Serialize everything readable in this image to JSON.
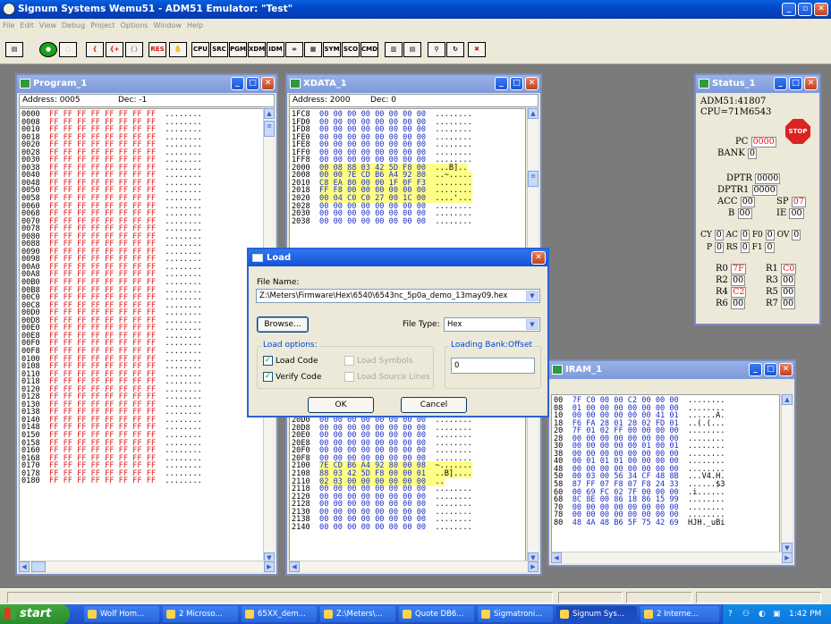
{
  "app": {
    "title": "Signum Systems Wemu51 - ADM51 Emulator: \"Test\""
  },
  "menu": [
    "File",
    "Edit",
    "View",
    "Debug",
    "Project",
    "Options",
    "Window",
    "Help"
  ],
  "toolbar": [
    "",
    "",
    "",
    "",
    "",
    "",
    "RES",
    "",
    "CPU",
    "SRC",
    "PGM",
    "XDM",
    "IDM",
    "",
    "",
    "SYM",
    "SCO",
    "CMD",
    "",
    "",
    "",
    "",
    ""
  ],
  "program": {
    "title": "Program_1",
    "address_label": "Address: 0005",
    "dec_label": "Dec: -1",
    "rows": [
      [
        "0000",
        "FF FF FF FF FF FF FF FF",
        "........"
      ],
      [
        "0008",
        "FF FF FF FF FF FF FF FF",
        "........"
      ],
      [
        "0010",
        "FF FF FF FF FF FF FF FF",
        "........"
      ],
      [
        "0018",
        "FF FF FF FF FF FF FF FF",
        "........"
      ],
      [
        "0020",
        "FF FF FF FF FF FF FF FF",
        "........"
      ],
      [
        "0028",
        "FF FF FF FF FF FF FF FF",
        "........"
      ],
      [
        "0030",
        "FF FF FF FF FF FF FF FF",
        "........"
      ],
      [
        "0038",
        "FF FF FF FF FF FF FF FF",
        "........"
      ],
      [
        "0040",
        "FF FF FF FF FF FF FF FF",
        "........"
      ],
      [
        "0048",
        "FF FF FF FF FF FF FF FF",
        "........"
      ],
      [
        "0050",
        "FF FF FF FF FF FF FF FF",
        "........"
      ],
      [
        "0058",
        "FF FF FF FF FF FF FF FF",
        "........"
      ],
      [
        "0060",
        "FF FF FF FF FF FF FF FF",
        "........"
      ],
      [
        "0068",
        "FF FF FF FF FF FF FF FF",
        "........"
      ],
      [
        "0070",
        "FF FF FF FF FF FF FF FF",
        "........"
      ],
      [
        "0078",
        "FF FF FF FF FF FF FF FF",
        "........"
      ],
      [
        "0080",
        "FF FF FF FF FF FF FF FF",
        "........"
      ],
      [
        "0088",
        "FF FF FF FF FF FF FF FF",
        "........"
      ],
      [
        "0090",
        "FF FF FF FF FF FF FF FF",
        "........"
      ],
      [
        "0098",
        "FF FF FF FF FF FF FF FF",
        "........"
      ],
      [
        "00A0",
        "FF FF FF FF FF FF FF FF",
        "........"
      ],
      [
        "00A8",
        "FF FF FF FF FF FF FF FF",
        "........"
      ],
      [
        "00B0",
        "FF FF FF FF FF FF FF FF",
        "........"
      ],
      [
        "00B8",
        "FF FF FF FF FF FF FF FF",
        "........"
      ],
      [
        "00C0",
        "FF FF FF FF FF FF FF FF",
        "........"
      ],
      [
        "00C8",
        "FF FF FF FF FF FF FF FF",
        "........"
      ],
      [
        "00D0",
        "FF FF FF FF FF FF FF FF",
        "........"
      ],
      [
        "00D8",
        "FF FF FF FF FF FF FF FF",
        "........"
      ],
      [
        "00E0",
        "FF FF FF FF FF FF FF FF",
        "........"
      ],
      [
        "00E8",
        "FF FF FF FF FF FF FF FF",
        "........"
      ],
      [
        "00F0",
        "FF FF FF FF FF FF FF FF",
        "........"
      ],
      [
        "00F8",
        "FF FF FF FF FF FF FF FF",
        "........"
      ],
      [
        "0100",
        "FF FF FF FF FF FF FF FF",
        "........"
      ],
      [
        "0108",
        "FF FF FF FF FF FF FF FF",
        "........"
      ],
      [
        "0110",
        "FF FF FF FF FF FF FF FF",
        "........"
      ],
      [
        "0118",
        "FF FF FF FF FF FF FF FF",
        "........"
      ],
      [
        "0120",
        "FF FF FF FF FF FF FF FF",
        "........"
      ],
      [
        "0128",
        "FF FF FF FF FF FF FF FF",
        "........"
      ],
      [
        "0130",
        "FF FF FF FF FF FF FF FF",
        "........"
      ],
      [
        "0138",
        "FF FF FF FF FF FF FF FF",
        "........"
      ],
      [
        "0140",
        "FF FF FF FF FF FF FF FF",
        "........"
      ],
      [
        "0148",
        "FF FF FF FF FF FF FF FF",
        "........"
      ],
      [
        "0150",
        "FF FF FF FF FF FF FF FF",
        "........"
      ],
      [
        "0158",
        "FF FF FF FF FF FF FF FF",
        "........"
      ],
      [
        "0160",
        "FF FF FF FF FF FF FF FF",
        "........"
      ],
      [
        "0168",
        "FF FF FF FF FF FF FF FF",
        "........"
      ],
      [
        "0170",
        "FF FF FF FF FF FF FF FF",
        "........"
      ],
      [
        "0178",
        "FF FF FF FF FF FF FF FF",
        "........"
      ],
      [
        "0180",
        "FF FF FF FF FF FF FF FF",
        "........"
      ]
    ]
  },
  "xdata": {
    "title": "XDATA_1",
    "address_label": "Address: 2000",
    "dec_label": "Dec: 0",
    "rows_top": [
      [
        "1FC8",
        "00 00 00 00 00 00 00 00",
        "........",
        false
      ],
      [
        "1FD0",
        "00 00 00 00 00 00 00 00",
        "........",
        false
      ],
      [
        "1FD8",
        "00 00 00 00 00 00 00 00",
        "........",
        false
      ],
      [
        "1FE0",
        "00 00 00 00 00 00 00 00",
        "........",
        false
      ],
      [
        "1FE8",
        "00 00 00 00 00 00 00 00",
        "........",
        false
      ],
      [
        "1FF0",
        "00 00 00 00 00 00 00 00",
        "........",
        false
      ],
      [
        "1FF8",
        "00 00 00 00 00 00 00 00",
        "........",
        false
      ],
      [
        "2000",
        "00 08 88 03 42 5D F8 00",
        "...B]..",
        true
      ],
      [
        "2008",
        "00 00 7E CD B6 A4 92 80",
        "..~.....",
        true
      ],
      [
        "2010",
        "C8 EA 80 00 00 1F 0F F3",
        "........",
        true
      ],
      [
        "2018",
        "FF F8 00 00 00 00 00 00",
        "........",
        true
      ],
      [
        "2020",
        "00 04 C0 C0 27 00 1C 00",
        "....'...",
        true
      ],
      [
        "2028",
        "00 00 00 00 00 00 00 00",
        "........",
        false
      ],
      [
        "2030",
        "00 00 00 00 00 00 00 00",
        "........",
        false
      ],
      [
        "2038",
        "00 00 00 00 00 00 00 00",
        "........",
        false
      ]
    ],
    "rows_bottom": [
      [
        "20D0",
        "00 00 00 00 00 00 00 00",
        "........",
        false
      ],
      [
        "20D8",
        "00 00 00 00 00 00 00 00",
        "........",
        false
      ],
      [
        "20E0",
        "00 00 00 00 00 00 00 00",
        "........",
        false
      ],
      [
        "20E8",
        "00 00 00 00 00 00 00 00",
        "........",
        false
      ],
      [
        "20F0",
        "00 00 00 00 00 00 00 00",
        "........",
        false
      ],
      [
        "20F8",
        "00 00 00 00 00 00 00 00",
        "........",
        false
      ],
      [
        "2100",
        "7E CD B6 A4 92 80 00 08",
        "~.......",
        true
      ],
      [
        "2108",
        "88 03 42 5D F8 00 00 01",
        "..B]....",
        true
      ],
      [
        "2110",
        "02 03 00 00 00 00 00 00",
        "..",
        true
      ],
      [
        "2118",
        "00 00 00 00 00 00 00 00",
        "........",
        false
      ],
      [
        "2120",
        "00 00 00 00 00 00 00 00",
        "........",
        false
      ],
      [
        "2128",
        "00 00 00 00 00 00 00 00",
        "........",
        false
      ],
      [
        "2130",
        "00 00 00 00 00 00 00 00",
        "........",
        false
      ],
      [
        "2138",
        "00 00 00 00 00 00 00 00",
        "........",
        false
      ],
      [
        "2140",
        "00 00 00 00 00 00 00 00",
        "........",
        false
      ]
    ]
  },
  "status": {
    "title": "Status_1",
    "line1": "ADM51:41807",
    "line2": "CPU=71M6543",
    "stop": "STOP",
    "pc_label": "PC",
    "pc": "0000",
    "bank_label": "BANK",
    "bank": "0",
    "dptr_label": "DPTR",
    "dptr": "0000",
    "dptr1_label": "DPTR1",
    "dptr1": "0000",
    "acc_label": "ACC",
    "acc": "00",
    "sp_label": "SP",
    "sp": "07",
    "b_label": "B",
    "b": "00",
    "ie_label": "IE",
    "ie": "00",
    "cy_label": "CY",
    "cy": "0",
    "ac_label": "AC",
    "ac": "0",
    "f0_label": "F0",
    "f0": "0",
    "ov_label": "OV",
    "ov": "0",
    "p_label": "P",
    "p": "0",
    "rs_label": "RS",
    "rs": "0",
    "f1_label": "F1",
    "f1": "0",
    "r0_label": "R0",
    "r0": "7F",
    "r1_label": "R1",
    "r1": "C0",
    "r2_label": "R2",
    "r2": "00",
    "r3_label": "R3",
    "r3": "00",
    "r4_label": "R4",
    "r4": "C2",
    "r5_label": "R5",
    "r5": "00",
    "r6_label": "R6",
    "r6": "00",
    "r7_label": "R7",
    "r7": "00"
  },
  "iram": {
    "title": "IRAM_1",
    "rows": [
      [
        "00",
        "7F C0 00 00 C2 00 00 00",
        "........"
      ],
      [
        "08",
        "01 00 00 00 00 00 00 00",
        "........"
      ],
      [
        "10",
        "00 00 00 00 00 00 41 01",
        "......A."
      ],
      [
        "18",
        "F6 FA 28 01 28 02 FD 01",
        "..(.(..."
      ],
      [
        "20",
        "7F 01 02 FF 00 00 00 00",
        "........"
      ],
      [
        "28",
        "00 00 00 00 00 00 00 00",
        "........"
      ],
      [
        "30",
        "00 00 00 00 00 01 00 01",
        "........"
      ],
      [
        "38",
        "00 00 00 00 00 00 00 00",
        "........"
      ],
      [
        "40",
        "00 01 01 01 00 00 00 00",
        "........"
      ],
      [
        "48",
        "00 00 00 00 00 00 00 00",
        "........"
      ],
      [
        "50",
        "00 03 00 56 34 CF 48 8B",
        "...V4.H."
      ],
      [
        "58",
        "87 FF 07 F8 07 F8 24 33",
        "......$3"
      ],
      [
        "60",
        "00 69 FC 02 7F 00 00 00",
        ".i......"
      ],
      [
        "68",
        "8C 8E 00 86 18 86 15 99",
        "........"
      ],
      [
        "70",
        "00 00 00 00 00 00 00 00",
        "........"
      ],
      [
        "78",
        "00 00 00 00 00 00 00 00",
        "........"
      ],
      [
        "80",
        "48 4A 48 B6 5F 75 42 69",
        "HJH._uBi"
      ]
    ]
  },
  "dialog": {
    "title": "Load",
    "file_name_label": "File Name:",
    "file_name": "Z:\\Meters\\Firmware\\Hex\\6540\\6543nc_5p0a_demo_13may09.hex",
    "browse": "Browse...",
    "file_type_label": "File Type:",
    "file_type": "Hex",
    "load_options_label": "Load options:",
    "load_code": "Load Code",
    "verify_code": "Verify Code",
    "load_symbols": "Load Symbols",
    "load_source_lines": "Load Source Lines",
    "bank_offset_label": "Loading Bank:Offset",
    "bank_offset": "0",
    "ok": "OK",
    "cancel": "Cancel"
  },
  "taskbar": {
    "start": "start",
    "tasks": [
      "Wolf Hom...",
      "2 Microso...",
      "65XX_dem...",
      "Z:\\Meters\\...",
      "Quote DB6...",
      "Sigmatroni...",
      "Signum Sys...",
      "2 Interne..."
    ],
    "clock": "1:42 PM"
  }
}
